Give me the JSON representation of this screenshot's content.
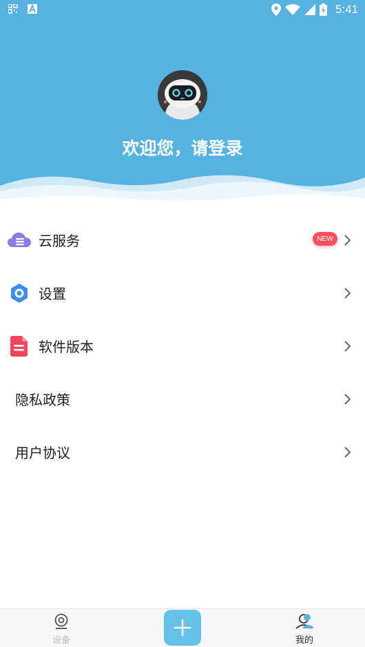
{
  "status_bar": {
    "time": "5:41",
    "left_icons": [
      "qr-icon",
      "font-a-icon"
    ],
    "right_icons": [
      "location-icon",
      "wifi-icon",
      "signal-icon",
      "battery-icon"
    ]
  },
  "header": {
    "welcome_text": "欢迎您，请登录",
    "background_color": "#56b3e1",
    "avatar": "robot-avatar"
  },
  "menu": {
    "items": [
      {
        "label": "云服务",
        "icon": "cloud-server-icon",
        "badge": "NEW"
      },
      {
        "label": "设置",
        "icon": "hexagon-settings-icon"
      },
      {
        "label": "软件版本",
        "icon": "document-icon"
      },
      {
        "label": "隐私政策"
      },
      {
        "label": "用户协议"
      }
    ]
  },
  "bottom_nav": {
    "device_label": "设备",
    "mine_label": "我的",
    "add_icon": "plus-icon",
    "add_color": "#63c2e6"
  }
}
